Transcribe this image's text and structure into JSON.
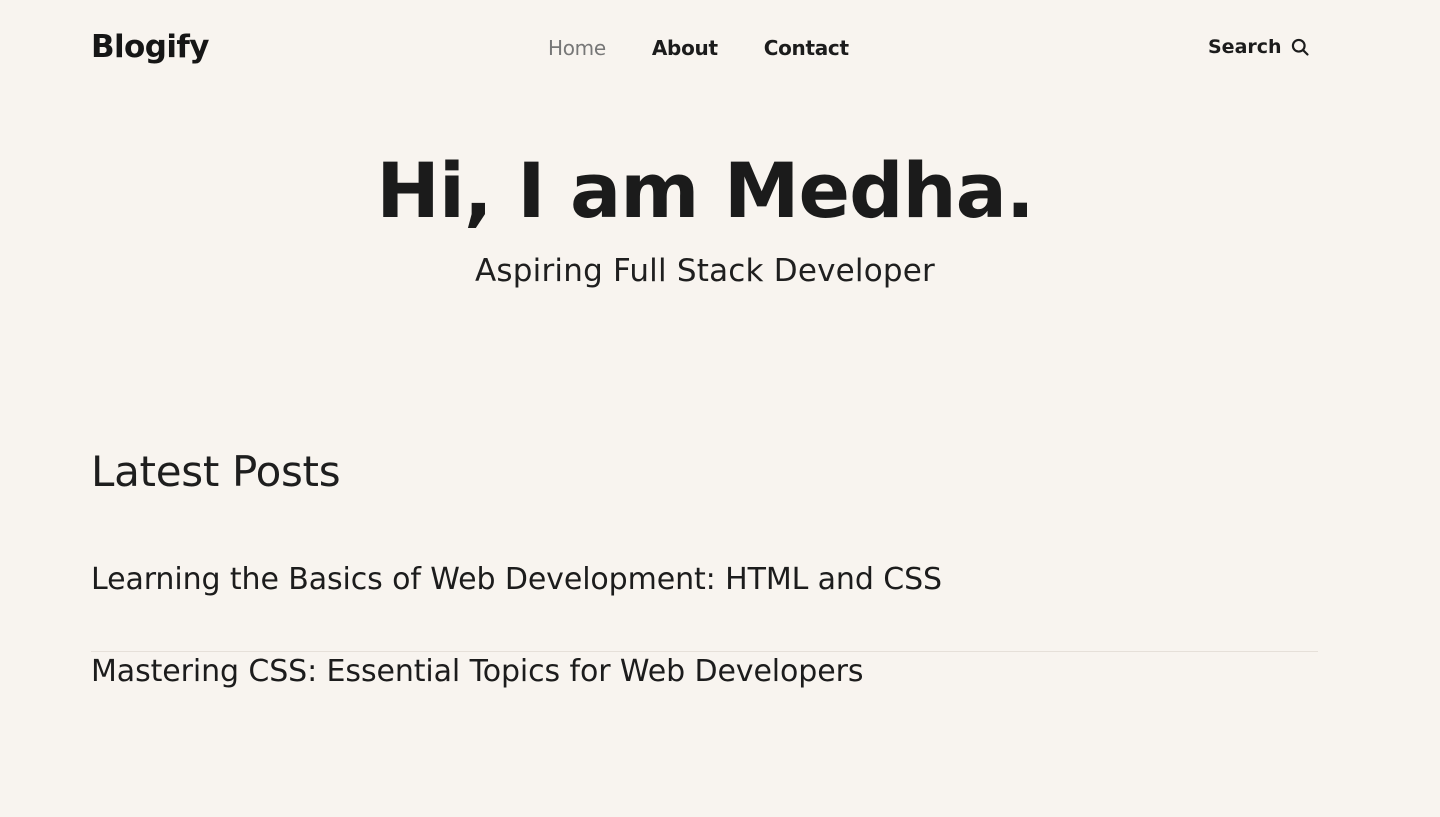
{
  "brand": {
    "name": "Blogify"
  },
  "nav": {
    "items": [
      {
        "label": "Home",
        "active": true
      },
      {
        "label": "About",
        "active": false
      },
      {
        "label": "Contact",
        "active": false
      }
    ]
  },
  "search": {
    "label": "Search",
    "icon": "search-icon"
  },
  "hero": {
    "title": "Hi, I am Medha.",
    "subtitle": "Aspiring Full Stack Developer"
  },
  "posts": {
    "heading": "Latest Posts",
    "items": [
      {
        "title": "Learning the Basics of Web Development: HTML and CSS"
      },
      {
        "title": "Mastering CSS: Essential Topics for Web Developers"
      }
    ]
  },
  "colors": {
    "background": "#f8f4ef",
    "text": "#1c1c1c",
    "nav_active": "#777777",
    "divider": "#e6e0d9"
  }
}
